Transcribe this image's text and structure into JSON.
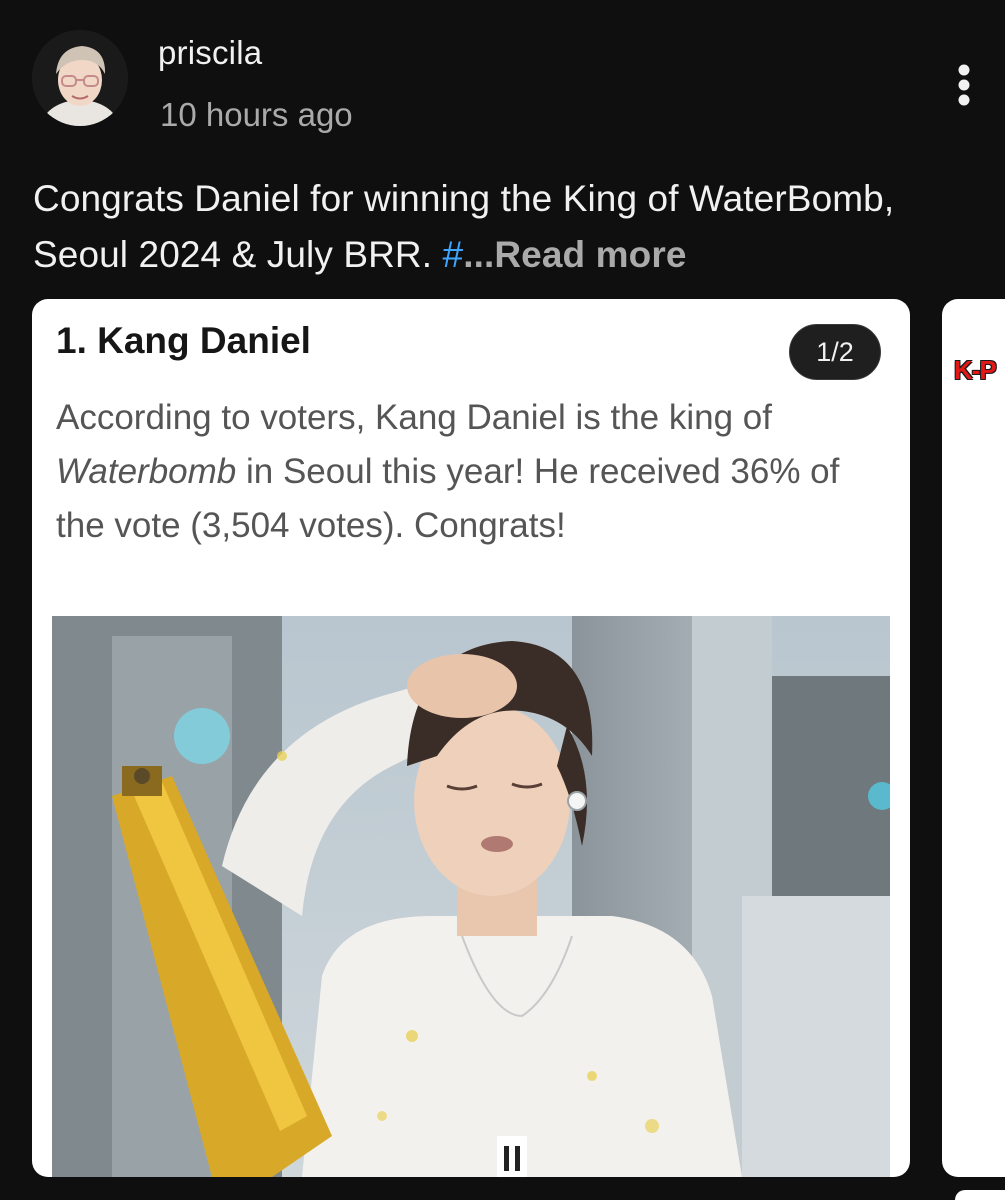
{
  "post": {
    "author": "priscila",
    "time": "10 hours ago",
    "caption": {
      "text": "Congrats Daniel for winning the King of WaterBomb, Seoul 2024 & July BRR.",
      "hashtag_fragment": "#",
      "read_more": "...Read more"
    },
    "icons": {
      "menu": "more-vertical-icon",
      "avatar": "profile-avatar"
    }
  },
  "carousel": {
    "current_card": {
      "title": "1. Kang Daniel",
      "page_indicator": "1/2",
      "body_before": "According to voters, Kang Daniel is the king of ",
      "body_italic": "Waterbomb",
      "body_after": " in Seoul this year! He received 36% of the vote (3,504 votes). Congrats!",
      "image": "performer-photo"
    },
    "next_card": {
      "logo_text": "K-P"
    }
  },
  "colors": {
    "background": "#0f0f0f",
    "text_primary": "#f1f1f1",
    "text_secondary": "#aaaaaa",
    "hashtag": "#3ea6ff",
    "card_bg": "#ffffff",
    "card_title": "#161616",
    "card_body": "#555555"
  }
}
